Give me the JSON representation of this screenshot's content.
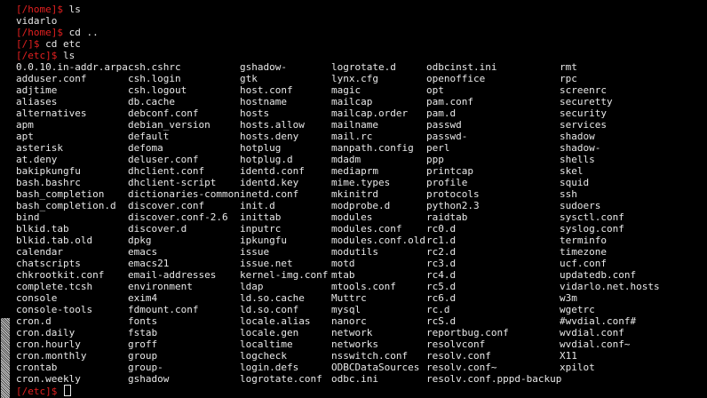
{
  "session": [
    {
      "prompt": "[/home]$ ",
      "command": "ls"
    },
    {
      "output": "vidarlo"
    },
    {
      "prompt": "[/home]$ ",
      "command": "cd .."
    },
    {
      "prompt": "[/]$ ",
      "command": "cd etc"
    },
    {
      "prompt": "[/etc]$ ",
      "command": "ls"
    }
  ],
  "listing_columns": [
    [
      "0.0.10.in-addr.arpa",
      "adduser.conf",
      "adjtime",
      "aliases",
      "alternatives",
      "apm",
      "apt",
      "asterisk",
      "at.deny",
      "bakipkungfu",
      "bash.bashrc",
      "bash_completion",
      "bash_completion.d",
      "bind",
      "blkid.tab",
      "blkid.tab.old",
      "calendar",
      "chatscripts",
      "chkrootkit.conf",
      "complete.tcsh",
      "console",
      "console-tools",
      "cron.d",
      "cron.daily",
      "cron.hourly",
      "cron.monthly",
      "crontab",
      "cron.weekly"
    ],
    [
      "csh.cshrc",
      "csh.login",
      "csh.logout",
      "db.cache",
      "debconf.conf",
      "debian_version",
      "default",
      "defoma",
      "deluser.conf",
      "dhclient.conf",
      "dhclient-script",
      "dictionaries-common",
      "discover.conf",
      "discover.conf-2.6",
      "discover.d",
      "dpkg",
      "emacs",
      "emacs21",
      "email-addresses",
      "environment",
      "exim4",
      "fdmount.conf",
      "fonts",
      "fstab",
      "groff",
      "group",
      "group-",
      "gshadow"
    ],
    [
      "gshadow-",
      "gtk",
      "host.conf",
      "hostname",
      "hosts",
      "hosts.allow",
      "hosts.deny",
      "hotplug",
      "hotplug.d",
      "identd.conf",
      "identd.key",
      "inetd.conf",
      "init.d",
      "inittab",
      "inputrc",
      "ipkungfu",
      "issue",
      "issue.net",
      "kernel-img.conf",
      "ldap",
      "ld.so.cache",
      "ld.so.conf",
      "locale.alias",
      "locale.gen",
      "localtime",
      "logcheck",
      "login.defs",
      "logrotate.conf"
    ],
    [
      "logrotate.d",
      "lynx.cfg",
      "magic",
      "mailcap",
      "mailcap.order",
      "mailname",
      "mail.rc",
      "manpath.config",
      "mdadm",
      "mediaprm",
      "mime.types",
      "mkinitrd",
      "modprobe.d",
      "modules",
      "modules.conf",
      "modules.conf.old",
      "modutils",
      "motd",
      "mtab",
      "mtools.conf",
      "Muttrc",
      "mysql",
      "nanorc",
      "network",
      "networks",
      "nsswitch.conf",
      "ODBCDataSources",
      "odbc.ini"
    ],
    [
      "odbcinst.ini",
      "openoffice",
      "opt",
      "pam.conf",
      "pam.d",
      "passwd",
      "passwd-",
      "perl",
      "ppp",
      "printcap",
      "profile",
      "protocols",
      "python2.3",
      "raidtab",
      "rc0.d",
      "rc1.d",
      "rc2.d",
      "rc3.d",
      "rc4.d",
      "rc5.d",
      "rc6.d",
      "rc.d",
      "rcS.d",
      "reportbug.conf",
      "resolvconf",
      "resolv.conf",
      "resolv.conf~",
      "resolv.conf.pppd-backup"
    ],
    [
      "rmt",
      "rpc",
      "screenrc",
      "securetty",
      "security",
      "services",
      "shadow",
      "shadow-",
      "shells",
      "skel",
      "squid",
      "ssh",
      "sudoers",
      "sysctl.conf",
      "syslog.conf",
      "terminfo",
      "timezone",
      "ucf.conf",
      "updatedb.conf",
      "vidarlo.net.hosts",
      "w3m",
      "wgetrc",
      "#wvdial.conf#",
      "wvdial.conf",
      "wvdial.conf~",
      "X11",
      "xpilot"
    ]
  ],
  "final_prompt": {
    "prompt": "[/etc]$ ",
    "command": ""
  },
  "colors": {
    "background": "#000000",
    "text": "#e8e8e8",
    "prompt": "#e32020"
  },
  "scrollbar": {
    "position_fraction": 1.0
  }
}
